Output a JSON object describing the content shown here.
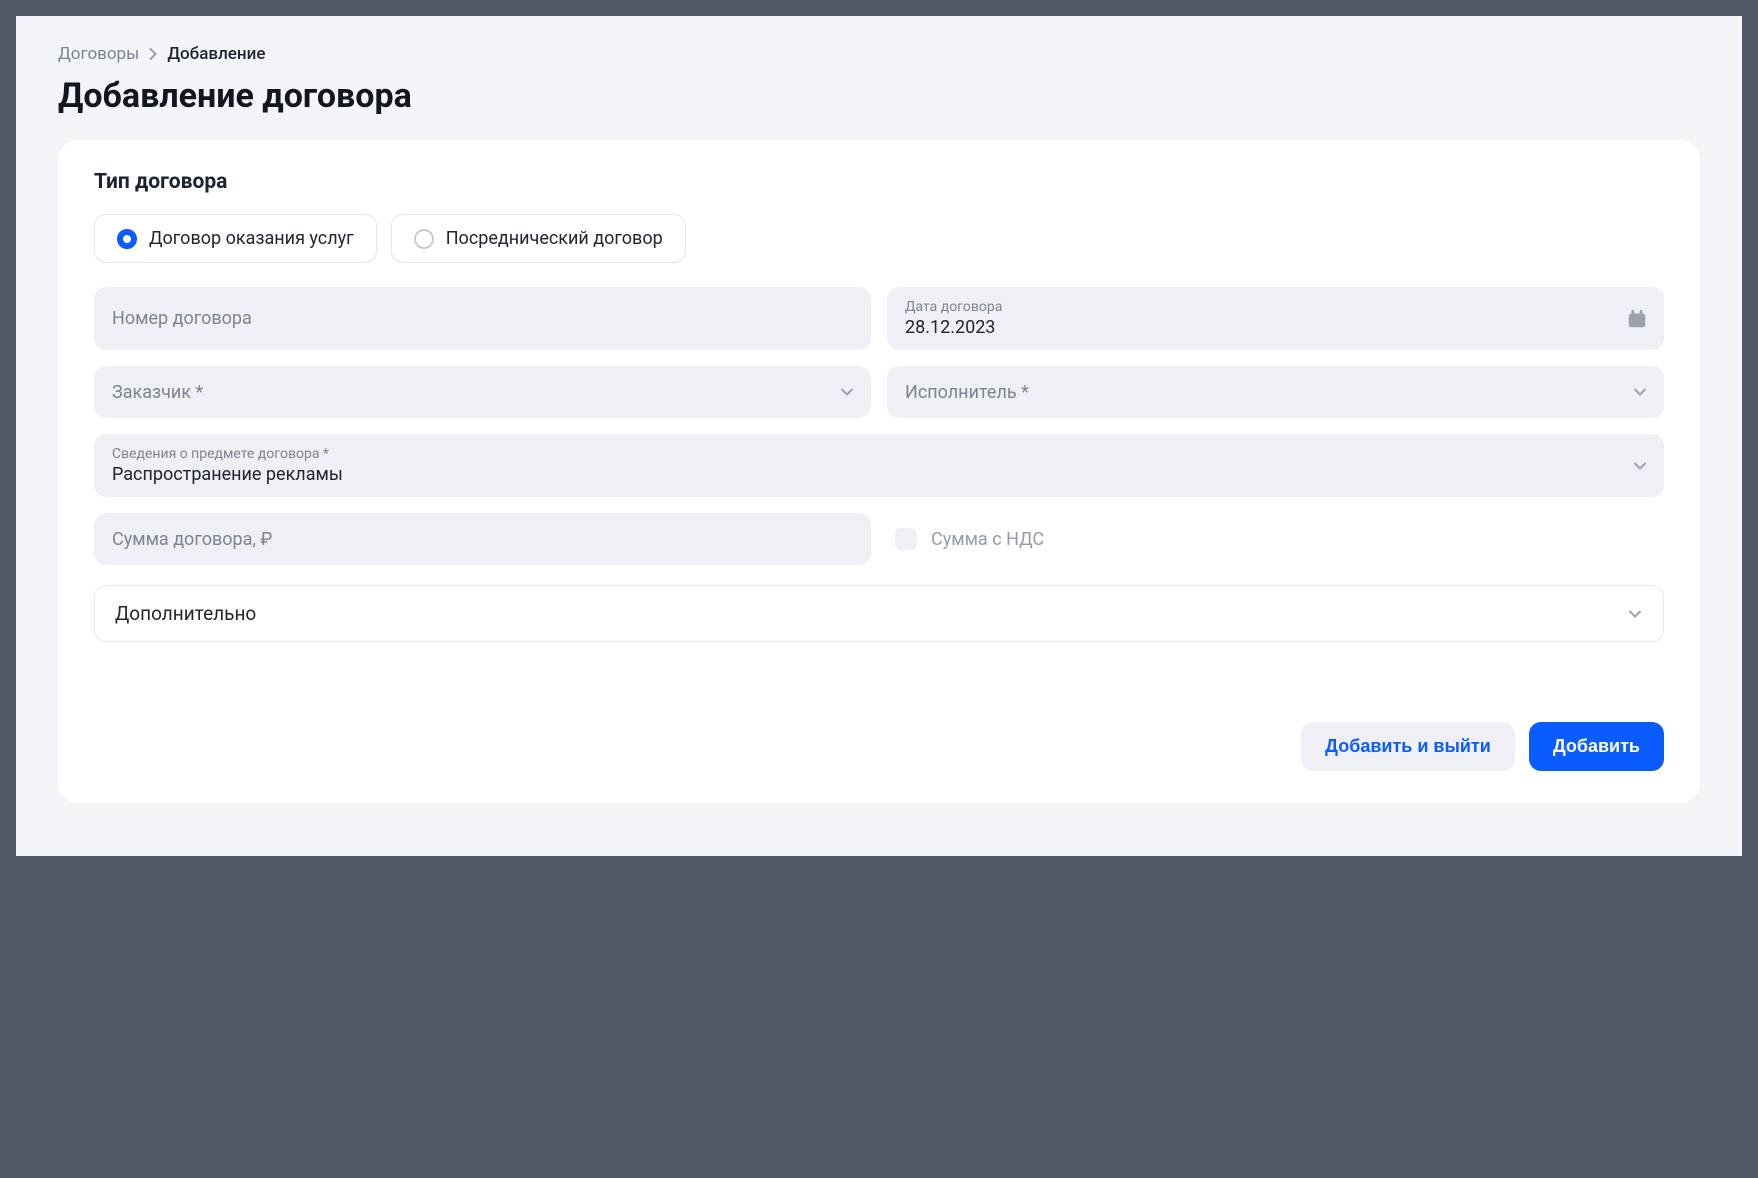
{
  "breadcrumb": {
    "parent": "Договоры",
    "current": "Добавление"
  },
  "page_title": "Добавление договора",
  "section": {
    "contract_type_heading": "Тип договора",
    "type_options": {
      "services": "Договор оказания услуг",
      "intermediary": "Посреднический договор"
    }
  },
  "fields": {
    "contract_number_placeholder": "Номер договора",
    "contract_date_label": "Дата договора",
    "contract_date_value": "28.12.2023",
    "customer_placeholder": "Заказчик *",
    "executor_placeholder": "Исполнитель *",
    "subject_label": "Сведения о предмете договора *",
    "subject_value": "Распространение рекламы",
    "amount_placeholder": "Сумма договора, ₽",
    "vat_checkbox_label": "Сумма с НДС",
    "additional_panel": "Дополнительно"
  },
  "buttons": {
    "add_and_exit": "Добавить и выйти",
    "add": "Добавить"
  }
}
